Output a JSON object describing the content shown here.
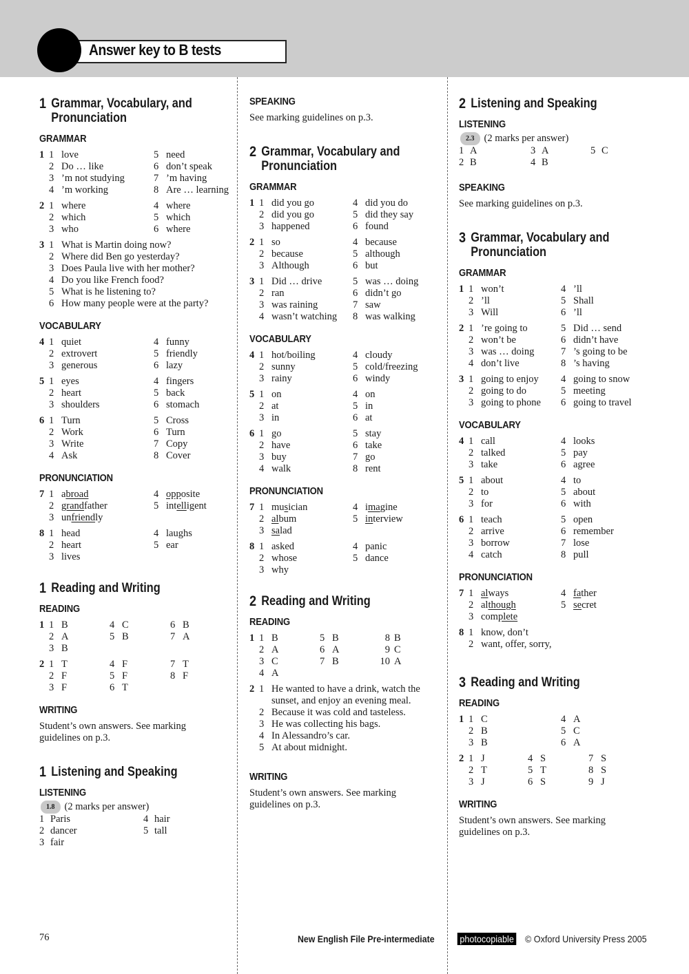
{
  "header": {
    "title": "Answer key to B tests"
  },
  "col1": {
    "s1": {
      "num": "1",
      "title": "Grammar, Vocabulary, and Pronunciation"
    },
    "grammar": "GRAMMAR",
    "g1": [
      [
        "1",
        "love"
      ],
      [
        "2",
        "Do … like"
      ],
      [
        "3",
        "’m not studying"
      ],
      [
        "4",
        "’m working"
      ],
      [
        "5",
        "need"
      ],
      [
        "6",
        "don’t speak"
      ],
      [
        "7",
        "’m having"
      ],
      [
        "8",
        "Are … learning"
      ]
    ],
    "g2": [
      [
        "1",
        "where"
      ],
      [
        "2",
        "which"
      ],
      [
        "3",
        "who"
      ],
      [
        "4",
        "where"
      ],
      [
        "5",
        "which"
      ],
      [
        "6",
        "where"
      ]
    ],
    "g3": [
      [
        "1",
        "What is Martin doing now?"
      ],
      [
        "2",
        "Where did Ben go yesterday?"
      ],
      [
        "3",
        "Does Paula live with her mother?"
      ],
      [
        "4",
        "Do you like French food?"
      ],
      [
        "5",
        "What is he listening to?"
      ],
      [
        "6",
        "How many people were at the party?"
      ]
    ],
    "vocabulary": "VOCABULARY",
    "v4": [
      [
        "1",
        "quiet"
      ],
      [
        "2",
        "extrovert"
      ],
      [
        "3",
        "generous"
      ],
      [
        "4",
        "funny"
      ],
      [
        "5",
        "friendly"
      ],
      [
        "6",
        "lazy"
      ]
    ],
    "v5": [
      [
        "1",
        "eyes"
      ],
      [
        "2",
        "heart"
      ],
      [
        "3",
        "shoulders"
      ],
      [
        "4",
        "fingers"
      ],
      [
        "5",
        "back"
      ],
      [
        "6",
        "stomach"
      ]
    ],
    "v6": [
      [
        "1",
        "Turn"
      ],
      [
        "2",
        "Work"
      ],
      [
        "3",
        "Write"
      ],
      [
        "4",
        "Ask"
      ],
      [
        "5",
        "Cross"
      ],
      [
        "6",
        "Turn"
      ],
      [
        "7",
        "Copy"
      ],
      [
        "8",
        "Cover"
      ]
    ],
    "pronunciation": "PRONUNCIATION",
    "p7": [
      [
        "1",
        "a",
        "broad",
        ""
      ],
      [
        "2",
        "",
        "grand",
        "father"
      ],
      [
        "3",
        "un",
        "friend",
        "ly"
      ],
      [
        "4",
        "",
        "opp",
        "osite"
      ],
      [
        "5",
        "int",
        "ell",
        "igent"
      ]
    ],
    "p8": [
      [
        "1",
        "head"
      ],
      [
        "2",
        "heart"
      ],
      [
        "3",
        "lives"
      ],
      [
        "4",
        "laughs"
      ],
      [
        "5",
        "ear"
      ]
    ],
    "s2": {
      "num": "1",
      "title": "Reading and Writing"
    },
    "reading": "READING",
    "r1": [
      [
        "1",
        "B"
      ],
      [
        "2",
        "A"
      ],
      [
        "3",
        "B"
      ],
      [
        "4",
        "C"
      ],
      [
        "5",
        "B"
      ],
      [
        "6",
        "B"
      ],
      [
        "7",
        "A"
      ]
    ],
    "r2": [
      [
        "1",
        "T"
      ],
      [
        "2",
        "F"
      ],
      [
        "3",
        "F"
      ],
      [
        "4",
        "F"
      ],
      [
        "5",
        "F"
      ],
      [
        "6",
        "T"
      ],
      [
        "7",
        "T"
      ],
      [
        "8",
        "F"
      ]
    ],
    "writing": "WRITING",
    "writing_text": "Student’s own answers. See marking guidelines on p.3.",
    "s3": {
      "num": "1",
      "title": "Listening and Speaking"
    },
    "listening": "LISTENING",
    "track": "1.8",
    "marks": "(2 marks per answer)",
    "l": [
      [
        "1",
        "Paris"
      ],
      [
        "2",
        "dancer"
      ],
      [
        "3",
        "fair"
      ],
      [
        "4",
        "hair"
      ],
      [
        "5",
        "tall"
      ]
    ]
  },
  "col2": {
    "speaking": "SPEAKING",
    "speaking_text": "See marking guidelines on p.3.",
    "s1": {
      "num": "2",
      "title": "Grammar, Vocabulary and Pronunciation"
    },
    "grammar": "GRAMMAR",
    "g1": [
      [
        "1",
        "did you go"
      ],
      [
        "2",
        "did you go"
      ],
      [
        "3",
        "happened"
      ],
      [
        "4",
        "did you do"
      ],
      [
        "5",
        "did they say"
      ],
      [
        "6",
        "found"
      ]
    ],
    "g2": [
      [
        "1",
        "so"
      ],
      [
        "2",
        "because"
      ],
      [
        "3",
        "Although"
      ],
      [
        "4",
        "because"
      ],
      [
        "5",
        "although"
      ],
      [
        "6",
        "but"
      ]
    ],
    "g3": [
      [
        "1",
        "Did … drive"
      ],
      [
        "2",
        "ran"
      ],
      [
        "3",
        "was raining"
      ],
      [
        "4",
        "wasn’t watching"
      ],
      [
        "5",
        "was … doing"
      ],
      [
        "6",
        "didn’t go"
      ],
      [
        "7",
        "saw"
      ],
      [
        "8",
        "was walking"
      ]
    ],
    "vocabulary": "VOCABULARY",
    "v4": [
      [
        "1",
        "hot/boiling"
      ],
      [
        "2",
        "sunny"
      ],
      [
        "3",
        "rainy"
      ],
      [
        "4",
        "cloudy"
      ],
      [
        "5",
        "cold/freezing"
      ],
      [
        "6",
        "windy"
      ]
    ],
    "v5": [
      [
        "1",
        "on"
      ],
      [
        "2",
        "at"
      ],
      [
        "3",
        "in"
      ],
      [
        "4",
        "on"
      ],
      [
        "5",
        "in"
      ],
      [
        "6",
        "at"
      ]
    ],
    "v6": [
      [
        "1",
        "go"
      ],
      [
        "2",
        "have"
      ],
      [
        "3",
        "buy"
      ],
      [
        "4",
        "walk"
      ],
      [
        "5",
        "stay"
      ],
      [
        "6",
        "take"
      ],
      [
        "7",
        "go"
      ],
      [
        "8",
        "rent"
      ]
    ],
    "pronunciation": "PRONUNCIATION",
    "p7": [
      [
        "1",
        "mu",
        "s",
        "ician"
      ],
      [
        "2",
        "",
        "al",
        "bum"
      ],
      [
        "3",
        "",
        "sa",
        "lad"
      ],
      [
        "4",
        "i",
        "ma",
        "gine"
      ],
      [
        "5",
        "",
        "in",
        "terview"
      ]
    ],
    "p8": [
      [
        "1",
        "asked"
      ],
      [
        "2",
        "whose"
      ],
      [
        "3",
        "why"
      ],
      [
        "4",
        "panic"
      ],
      [
        "5",
        "dance"
      ]
    ],
    "s2": {
      "num": "2",
      "title": "Reading and Writing"
    },
    "reading": "READING",
    "r1": [
      [
        "1",
        "B"
      ],
      [
        "2",
        "A"
      ],
      [
        "3",
        "C"
      ],
      [
        "4",
        "A"
      ],
      [
        "5",
        "B"
      ],
      [
        "6",
        "A"
      ],
      [
        "7",
        "B"
      ],
      [
        "8",
        "B"
      ],
      [
        "9",
        "C"
      ],
      [
        "10",
        "A"
      ]
    ],
    "r2": [
      [
        "1",
        "He wanted to have a drink, watch the sunset, and enjoy an evening meal."
      ],
      [
        "2",
        "Because it was cold and tasteless."
      ],
      [
        "3",
        "He was collecting his bags."
      ],
      [
        "4",
        "In Alessandro’s car."
      ],
      [
        "5",
        "At about midnight."
      ]
    ],
    "writing": "WRITING",
    "writing_text": "Student’s own answers. See marking guidelines on p.3."
  },
  "col3": {
    "s1": {
      "num": "2",
      "title": "Listening and Speaking"
    },
    "listening": "LISTENING",
    "track": "2.3",
    "marks": "(2 marks per answer)",
    "l": [
      [
        "1",
        "A"
      ],
      [
        "2",
        "B"
      ],
      [
        "3",
        "A"
      ],
      [
        "4",
        "B"
      ],
      [
        "5",
        "C"
      ]
    ],
    "speaking": "SPEAKING",
    "speaking_text": "See marking guidelines on p.3.",
    "s2": {
      "num": "3",
      "title": "Grammar, Vocabulary and Pronunciation"
    },
    "grammar": "GRAMMAR",
    "g1": [
      [
        "1",
        "won’t"
      ],
      [
        "2",
        "’ll"
      ],
      [
        "3",
        "Will"
      ],
      [
        "4",
        "’ll"
      ],
      [
        "5",
        "Shall"
      ],
      [
        "6",
        "’ll"
      ]
    ],
    "g2": [
      [
        "1",
        "’re going to"
      ],
      [
        "2",
        "won’t be"
      ],
      [
        "3",
        "was … doing"
      ],
      [
        "4",
        "don’t live"
      ],
      [
        "5",
        "Did … send"
      ],
      [
        "6",
        "didn’t have"
      ],
      [
        "7",
        "’s going to be"
      ],
      [
        "8",
        "’s having"
      ]
    ],
    "g3": [
      [
        "1",
        "going to enjoy"
      ],
      [
        "2",
        "going to do"
      ],
      [
        "3",
        "going to phone"
      ],
      [
        "4",
        "going to snow"
      ],
      [
        "5",
        "meeting"
      ],
      [
        "6",
        "going to travel"
      ]
    ],
    "vocabulary": "VOCABULARY",
    "v4": [
      [
        "1",
        "call"
      ],
      [
        "2",
        "talked"
      ],
      [
        "3",
        "take"
      ],
      [
        "4",
        "looks"
      ],
      [
        "5",
        "pay"
      ],
      [
        "6",
        "agree"
      ]
    ],
    "v5": [
      [
        "1",
        "about"
      ],
      [
        "2",
        "to"
      ],
      [
        "3",
        "for"
      ],
      [
        "4",
        "to"
      ],
      [
        "5",
        "about"
      ],
      [
        "6",
        "with"
      ]
    ],
    "v6": [
      [
        "1",
        "teach"
      ],
      [
        "2",
        "arrive"
      ],
      [
        "3",
        "borrow"
      ],
      [
        "4",
        "catch"
      ],
      [
        "5",
        "open"
      ],
      [
        "6",
        "remember"
      ],
      [
        "7",
        "lose"
      ],
      [
        "8",
        "pull"
      ]
    ],
    "pronunciation": "PRONUNCIATION",
    "p7": [
      [
        "1",
        "",
        "al",
        "ways"
      ],
      [
        "2",
        "al",
        "though",
        ""
      ],
      [
        "3",
        "com",
        "plete",
        ""
      ],
      [
        "4",
        "",
        "fa",
        "ther"
      ],
      [
        "5",
        "",
        "se",
        "cret"
      ]
    ],
    "p8": [
      [
        "1",
        "know, don’t"
      ],
      [
        "2",
        "want, offer, sorry,"
      ]
    ],
    "s3": {
      "num": "3",
      "title": "Reading and Writing"
    },
    "reading": "READING",
    "r1": [
      [
        "1",
        "C"
      ],
      [
        "2",
        "B"
      ],
      [
        "3",
        "B"
      ],
      [
        "4",
        "A"
      ],
      [
        "5",
        "C"
      ],
      [
        "6",
        "A"
      ]
    ],
    "r2": [
      [
        "1",
        "J"
      ],
      [
        "2",
        "T"
      ],
      [
        "3",
        "J"
      ],
      [
        "4",
        "S"
      ],
      [
        "5",
        "T"
      ],
      [
        "6",
        "S"
      ],
      [
        "7",
        "S"
      ],
      [
        "8",
        "S"
      ],
      [
        "9",
        "J"
      ]
    ],
    "writing": "WRITING",
    "writing_text": "Student’s own answers. See marking guidelines on p.3."
  },
  "footer": {
    "page_number": "76",
    "book": "New English File  Pre-intermediate",
    "photocopiable": "photocopiable",
    "copyright": "© Oxford University Press 2005"
  }
}
